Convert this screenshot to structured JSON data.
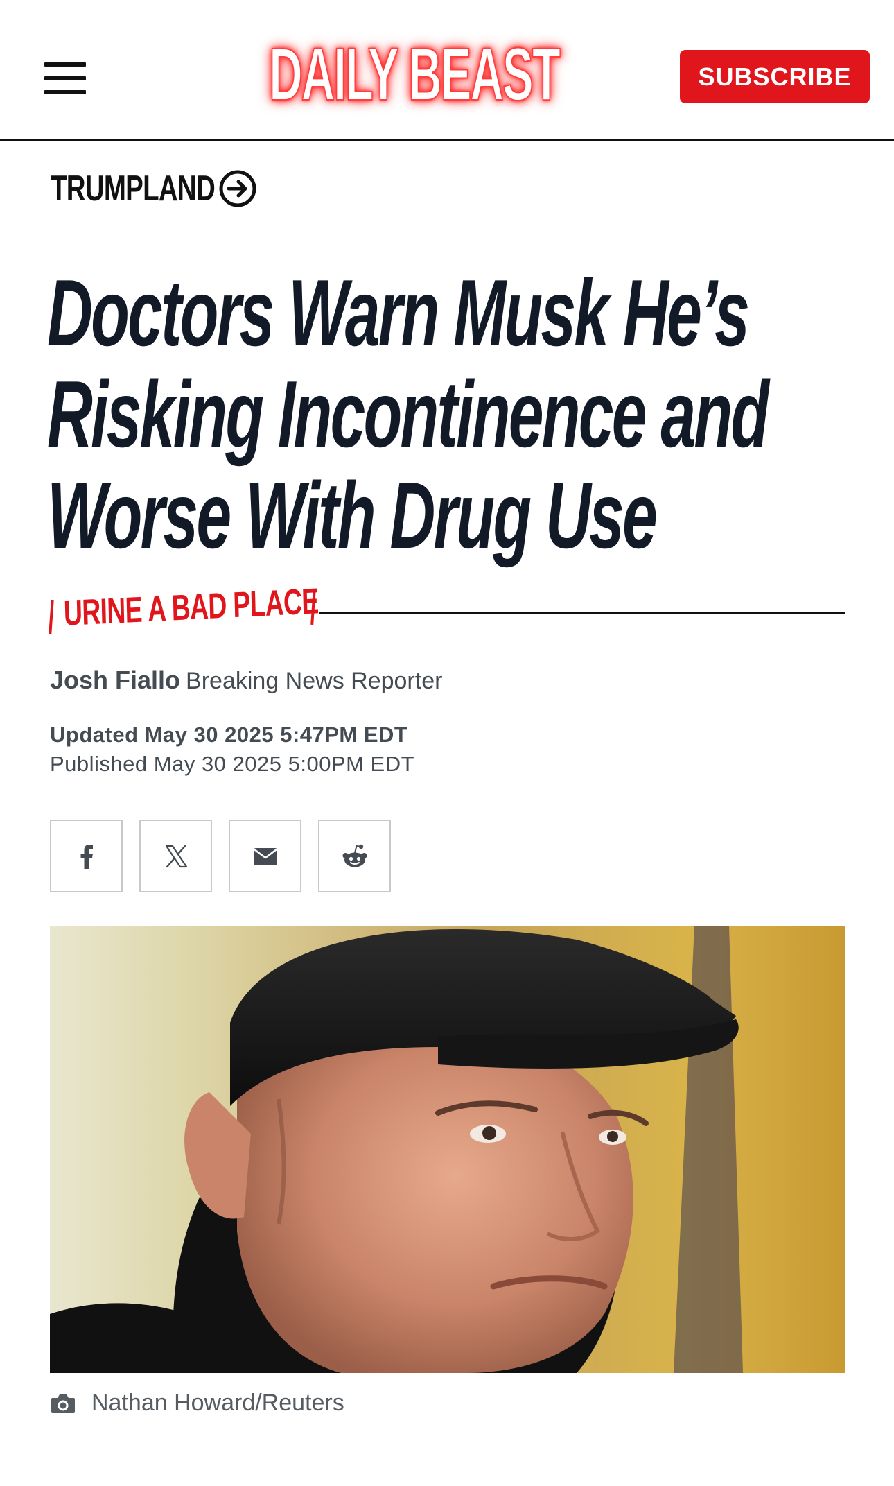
{
  "header": {
    "logo_text": "DAILY BEAST",
    "subscribe_label": "SUBSCRIBE",
    "menu_icon": "hamburger-menu-icon"
  },
  "section": {
    "label": "TRUMPLAND",
    "icon": "circle-arrow-right-icon"
  },
  "article": {
    "headline": "Doctors Warn Musk He’s Risking Incontinence and Worse With Drug Use",
    "kicker": "URINE A BAD PLACE",
    "author": "Josh Fiallo",
    "author_role": "Breaking News Reporter",
    "updated": "Updated May 30 2025 5:47PM EDT",
    "published": "Published May 30 2025 5:00PM EDT"
  },
  "share": {
    "buttons": [
      {
        "name": "facebook",
        "icon": "facebook-icon"
      },
      {
        "name": "x",
        "icon": "x-icon"
      },
      {
        "name": "email",
        "icon": "email-icon"
      },
      {
        "name": "reddit",
        "icon": "reddit-icon"
      }
    ]
  },
  "image": {
    "credit": "Nathan Howard/Reuters",
    "credit_icon": "camera-icon"
  },
  "colors": {
    "brand_red": "#e0161c",
    "headline": "#111a26",
    "meta_text": "#444b52"
  }
}
